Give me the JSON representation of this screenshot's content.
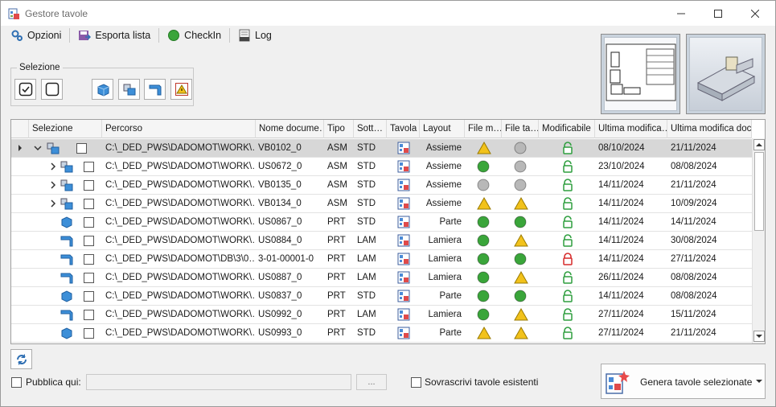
{
  "window": {
    "title": "Gestore tavole"
  },
  "toolbar": {
    "opzioni": "Opzioni",
    "esporta": "Esporta lista",
    "checkin": "CheckIn",
    "log": "Log"
  },
  "selezione": {
    "legend": "Selezione"
  },
  "grid": {
    "columns": [
      "Selezione",
      "Percorso",
      "Nome docume…",
      "Tipo",
      "Sott…",
      "Tavola",
      "Layout",
      "File m…",
      "File ta…",
      "Modificabile",
      "Ultima modifica…",
      "Ultima modifica doc"
    ],
    "rows": [
      {
        "level": 0,
        "expand": "down",
        "kind": "asm",
        "path": "C:\\_DED_PWS\\DADOMOT\\WORK\\…",
        "name": "VB0102_0",
        "tipo": "ASM",
        "sott": "STD",
        "layout": "Assieme",
        "fm": "warn",
        "ft": "gray",
        "lock": "open",
        "um": "08/10/2024",
        "umd": "21/11/2024"
      },
      {
        "level": 1,
        "expand": "right",
        "kind": "asm",
        "path": "C:\\_DED_PWS\\DADOMOT\\WORK\\…",
        "name": "US0672_0",
        "tipo": "ASM",
        "sott": "STD",
        "layout": "Assieme",
        "fm": "green",
        "ft": "gray",
        "lock": "open",
        "um": "23/10/2024",
        "umd": "08/08/2024"
      },
      {
        "level": 1,
        "expand": "right",
        "kind": "asm",
        "path": "C:\\_DED_PWS\\DADOMOT\\WORK\\…",
        "name": "VB0135_0",
        "tipo": "ASM",
        "sott": "STD",
        "layout": "Assieme",
        "fm": "gray",
        "ft": "gray",
        "lock": "open",
        "um": "14/11/2024",
        "umd": "21/11/2024"
      },
      {
        "level": 1,
        "expand": "right",
        "kind": "asm",
        "path": "C:\\_DED_PWS\\DADOMOT\\WORK\\…",
        "name": "VB0134_0",
        "tipo": "ASM",
        "sott": "STD",
        "layout": "Assieme",
        "fm": "warn",
        "ft": "warn",
        "lock": "open",
        "um": "14/11/2024",
        "umd": "10/09/2024"
      },
      {
        "level": 1,
        "expand": "",
        "kind": "prt",
        "path": "C:\\_DED_PWS\\DADOMOT\\WORK\\…",
        "name": "US0867_0",
        "tipo": "PRT",
        "sott": "STD",
        "layout": "Parte",
        "fm": "green",
        "ft": "green",
        "lock": "open",
        "um": "14/11/2024",
        "umd": "14/11/2024"
      },
      {
        "level": 1,
        "expand": "",
        "kind": "lam",
        "path": "C:\\_DED_PWS\\DADOMOT\\WORK\\…",
        "name": "US0884_0",
        "tipo": "PRT",
        "sott": "LAM",
        "layout": "Lamiera",
        "fm": "green",
        "ft": "warn",
        "lock": "open",
        "um": "14/11/2024",
        "umd": "30/08/2024"
      },
      {
        "level": 1,
        "expand": "",
        "kind": "lam",
        "path": "C:\\_DED_PWS\\DADOMOT\\DB\\3\\0…",
        "name": "3-01-00001-0",
        "tipo": "PRT",
        "sott": "LAM",
        "layout": "Lamiera",
        "fm": "green",
        "ft": "green",
        "lock": "closed",
        "um": "14/11/2024",
        "umd": "27/11/2024"
      },
      {
        "level": 1,
        "expand": "",
        "kind": "lam",
        "path": "C:\\_DED_PWS\\DADOMOT\\WORK\\…",
        "name": "US0887_0",
        "tipo": "PRT",
        "sott": "LAM",
        "layout": "Lamiera",
        "fm": "green",
        "ft": "warn",
        "lock": "open",
        "um": "26/11/2024",
        "umd": "08/08/2024"
      },
      {
        "level": 1,
        "expand": "",
        "kind": "prt",
        "path": "C:\\_DED_PWS\\DADOMOT\\WORK\\…",
        "name": "US0837_0",
        "tipo": "PRT",
        "sott": "STD",
        "layout": "Parte",
        "fm": "green",
        "ft": "green",
        "lock": "open",
        "um": "14/11/2024",
        "umd": "08/08/2024"
      },
      {
        "level": 1,
        "expand": "",
        "kind": "lam",
        "path": "C:\\_DED_PWS\\DADOMOT\\WORK\\…",
        "name": "US0992_0",
        "tipo": "PRT",
        "sott": "LAM",
        "layout": "Lamiera",
        "fm": "green",
        "ft": "warn",
        "lock": "open",
        "um": "27/11/2024",
        "umd": "15/11/2024"
      },
      {
        "level": 1,
        "expand": "",
        "kind": "prt",
        "path": "C:\\_DED_PWS\\DADOMOT\\WORK\\…",
        "name": "US0993_0",
        "tipo": "PRT",
        "sott": "STD",
        "layout": "Parte",
        "fm": "warn",
        "ft": "warn",
        "lock": "open",
        "um": "27/11/2024",
        "umd": "21/11/2024"
      }
    ]
  },
  "bottom": {
    "pubblica": "Pubblica qui:",
    "browse": "...",
    "sovrascrivi": "Sovrascrivi tavole esistenti",
    "genera": "Genera tavole selezionate"
  },
  "colors": {
    "green": "#3aa53a",
    "warn": "#f2c21b",
    "gray": "#b8b8b8",
    "lock_open": "#2e9e3e",
    "lock_closed": "#d62a2a"
  }
}
